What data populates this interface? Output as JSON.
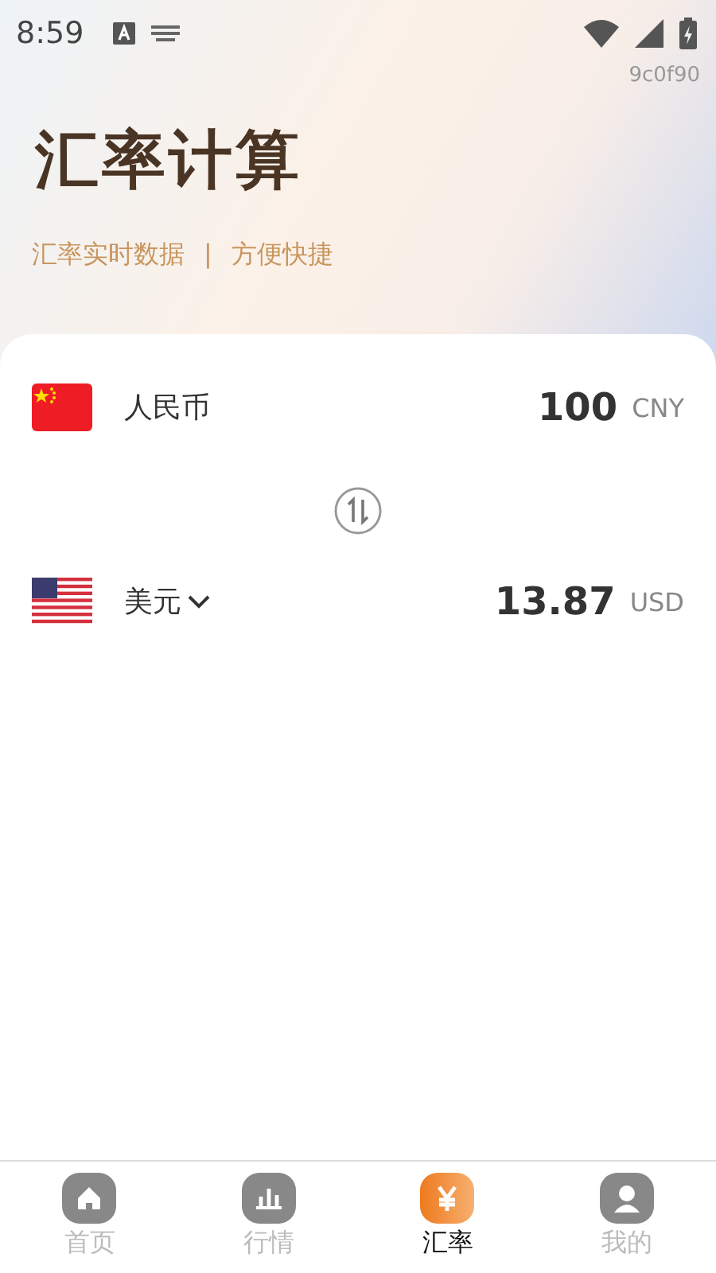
{
  "status_bar": {
    "time": "8:59"
  },
  "header": {
    "device_code": "9c0f90",
    "title": "汇率计算",
    "subtitle": "汇率实时数据",
    "separator": "|",
    "subtitle_2": "方便快捷"
  },
  "currencies": [
    {
      "kind": "cn",
      "name": "人民币",
      "dropdown": false,
      "amount": "100",
      "code": "CNY"
    },
    {
      "kind": "us",
      "name": "美元",
      "dropdown": true,
      "amount": "13.87",
      "code": "USD"
    }
  ],
  "tab_bar": [
    {
      "kind": "home",
      "label": "首页",
      "selected": false
    },
    {
      "kind": "chart",
      "label": "行情",
      "selected": false
    },
    {
      "kind": "yen",
      "label": "汇率",
      "selected": true
    },
    {
      "kind": "user",
      "label": "我的",
      "selected": false
    }
  ]
}
